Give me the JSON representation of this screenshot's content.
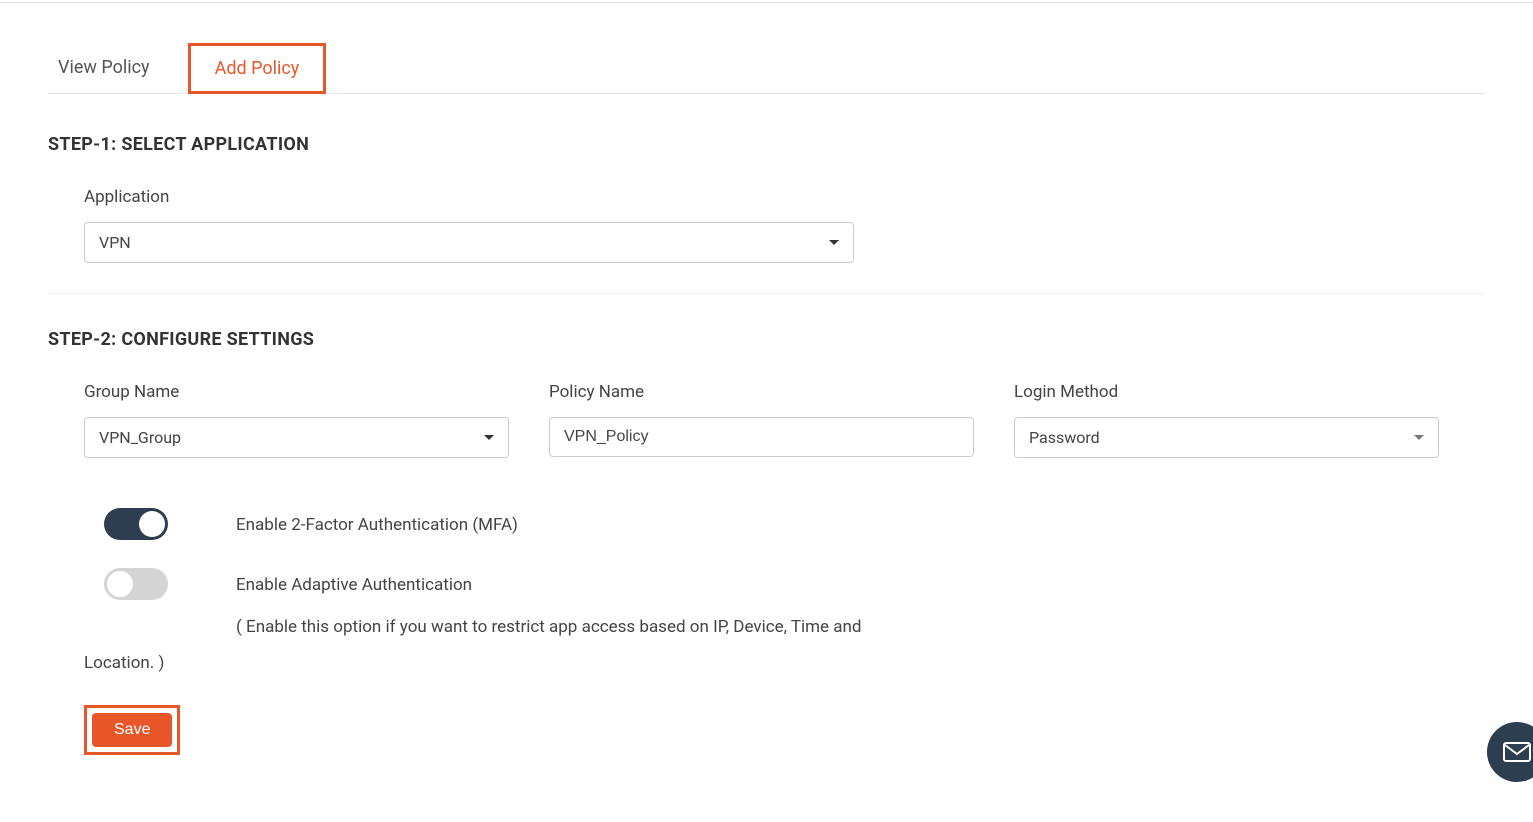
{
  "tabs": {
    "view_policy": "View Policy",
    "add_policy": "Add Policy"
  },
  "step1": {
    "title": "STEP-1: SELECT APPLICATION",
    "application_label": "Application",
    "application_value": "VPN"
  },
  "step2": {
    "title": "STEP-2: CONFIGURE SETTINGS",
    "group_name_label": "Group Name",
    "group_name_value": "VPN_Group",
    "policy_name_label": "Policy Name",
    "policy_name_value": "VPN_Policy",
    "login_method_label": "Login Method",
    "login_method_value": "Password",
    "mfa_label": "Enable 2-Factor Authentication (MFA)",
    "adaptive_label": "Enable Adaptive Authentication",
    "adaptive_desc_part1": "( Enable this option if you want to restrict app access based on IP, Device, Time and",
    "adaptive_desc_part2": "Location. )"
  },
  "save_label": "Save"
}
